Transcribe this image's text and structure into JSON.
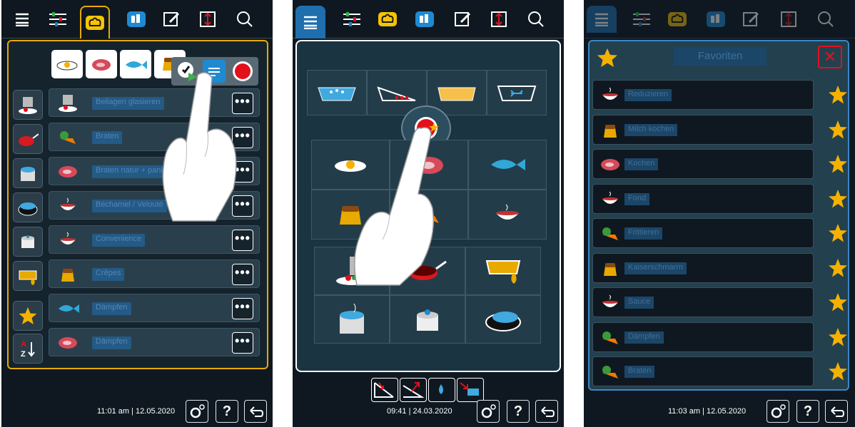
{
  "colors": {
    "accent_yellow": "#e8a900",
    "accent_blue": "#3d86c6",
    "red": "#e3101b",
    "star": "#f6b100",
    "background": "#0f1820"
  },
  "screen1": {
    "topbar_icons": [
      "menu-icon",
      "settings-sliders-icon",
      "chef-hat-icon",
      "layout-icon",
      "edit-icon",
      "transfer-icon",
      "search-icon"
    ],
    "category_tiles": [
      "egg-icon",
      "meat-icon",
      "fish-icon",
      "dessert-icon",
      "vegetable-icon",
      "cup-icon"
    ],
    "popup_icons": [
      "clock-play-icon",
      "list-icon",
      "record-icon"
    ],
    "side_icons": [
      "glaze-pot-icon",
      "frying-pan-icon",
      "steam-pot-icon",
      "roasting-pan-icon",
      "saucepan-icon",
      "baking-dish-icon",
      "star-icon",
      "sort-az-icon"
    ],
    "rows": [
      {
        "label": "Beilagen glasieren",
        "icon": "glaze-pot-icon"
      },
      {
        "label": "Braten",
        "icon": "vegetable-icon"
      },
      {
        "label": "Braten natur + paniert",
        "icon": "meat-icon"
      },
      {
        "label": "Béchamel / Velouté",
        "icon": "bowl-icon"
      },
      {
        "label": "Convenience",
        "icon": "bowl-icon"
      },
      {
        "label": "Crêpes",
        "icon": "dessert-icon"
      },
      {
        "label": "Dämpfen",
        "icon": "fish-icon"
      },
      {
        "label": "Dämpfen",
        "icon": "meat-icon"
      }
    ],
    "more_label": "•••",
    "time": "11:01 am",
    "date": "12.05.2020",
    "help_label": "?"
  },
  "screen2": {
    "mode_icons": [
      "water-bath-icon",
      "grill-tray-icon",
      "baking-tray-icon",
      "container-icon"
    ],
    "food_icons": [
      "egg-icon",
      "meat-icon",
      "fish-icon",
      "dessert-icon",
      "vegetable-icon",
      "bowl-icon"
    ],
    "equipment_icons": [
      "grater-plate-icon",
      "frying-pan-icon",
      "baking-dish-icon",
      "steam-pot-icon",
      "saucepan-icon",
      "roasting-pan-icon"
    ],
    "bottom_icons": [
      "cool-down-icon",
      "heat-up-icon",
      "humidify-icon",
      "unload-icon"
    ],
    "time": "09:41",
    "date": "24.03.2020",
    "help_label": "?"
  },
  "screen3": {
    "title": "Favoriten",
    "close_label": "✕",
    "rows": [
      {
        "label": "Reduzieren",
        "icon": "bowl-icon"
      },
      {
        "label": "Milch kochen",
        "icon": "dessert-icon"
      },
      {
        "label": "Kochen",
        "icon": "meat-icon"
      },
      {
        "label": "Fond",
        "icon": "bowl-icon"
      },
      {
        "label": "Frittieren",
        "icon": "vegetable-icon"
      },
      {
        "label": "Kaiserschmarrn",
        "icon": "dessert-icon"
      },
      {
        "label": "Sauce",
        "icon": "bowl-icon"
      },
      {
        "label": "Dämpfen",
        "icon": "vegetable-icon"
      },
      {
        "label": "Braten",
        "icon": "vegetable-icon"
      }
    ],
    "time": "11:03 am",
    "date": "12.05.2020",
    "help_label": "?"
  }
}
